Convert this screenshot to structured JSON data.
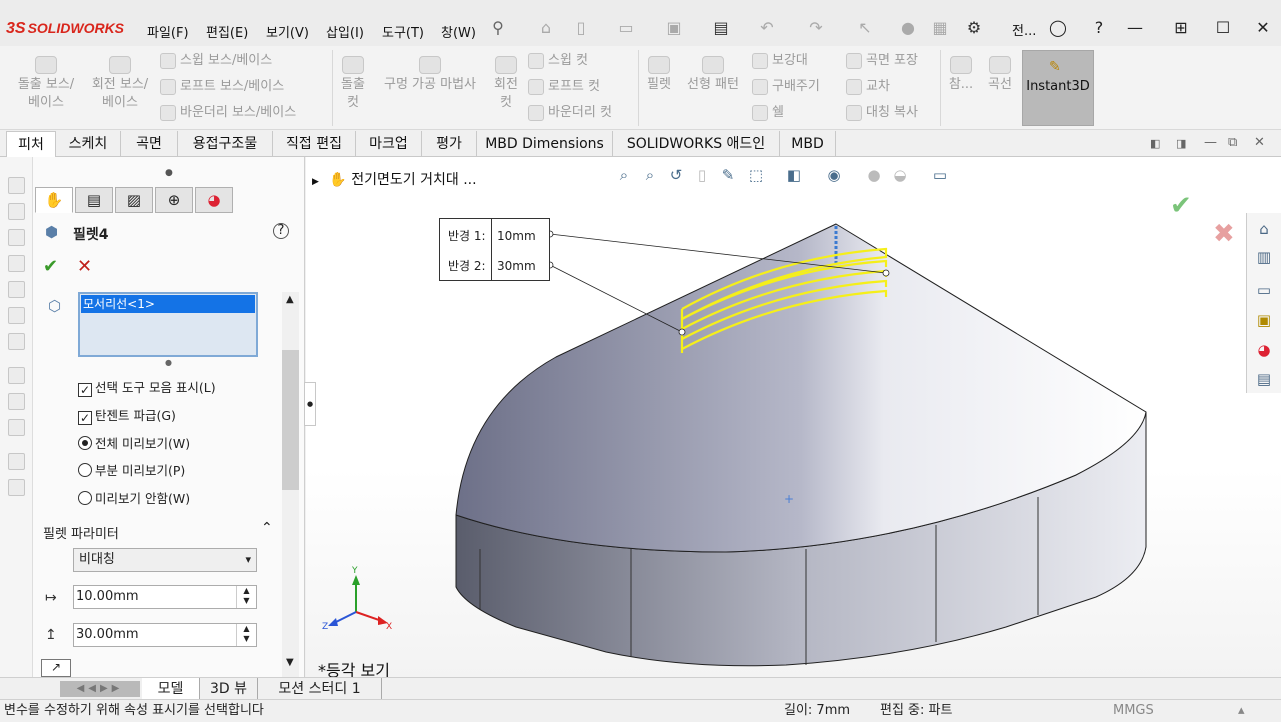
{
  "app": {
    "logo_prefix": "3S",
    "logo_text": "SOLIDWORKS",
    "doc_title_short": "전..."
  },
  "menu": [
    "파일(F)",
    "편집(E)",
    "보기(V)",
    "삽입(I)",
    "도구(T)",
    "창(W)"
  ],
  "command_manager": {
    "extrude_boss": [
      "돌출 보스/",
      "베이스"
    ],
    "revolve_boss": [
      "회전 보스/",
      "베이스"
    ],
    "sweep_boss": "스윕 보스/베이스",
    "loft_boss": "로프트 보스/베이스",
    "boundary_boss": "바운더리 보스/베이스",
    "extrude_cut": [
      "돌출",
      "컷"
    ],
    "hole_wizard": "구멍 가공 마법사",
    "revolve_cut": [
      "회전",
      "컷"
    ],
    "sweep_cut": "스윕 컷",
    "loft_cut": "로프트 컷",
    "boundary_cut": "바운더리 컷",
    "fillet": "필렛",
    "linear_pattern": "선형 패턴",
    "rib": "보강대",
    "draft": "구배주기",
    "shell": "쉘",
    "wrap": "곡면 포장",
    "intersect": "교차",
    "mirror": "대칭 복사",
    "reference": "참...",
    "curves": "곡선",
    "instant3d": "Instant3D"
  },
  "tabs": [
    "피처",
    "스케치",
    "곡면",
    "용접구조물",
    "직접 편집",
    "마크업",
    "평가",
    "MBD Dimensions",
    "SOLIDWORKS 애드인",
    "MBD"
  ],
  "property_manager": {
    "title": "필렛4",
    "edge_item": "모서리선<1>",
    "options": [
      {
        "label": "선택 도구 모음 표시(L)",
        "type": "checkbox",
        "checked": true
      },
      {
        "label": "탄젠트 파급(G)",
        "type": "checkbox",
        "checked": true
      },
      {
        "label": "전체 미리보기(W)",
        "type": "radio",
        "checked": true
      },
      {
        "label": "부분 미리보기(P)",
        "type": "radio",
        "checked": false
      },
      {
        "label": "미리보기 안함(W)",
        "type": "radio",
        "checked": false
      }
    ],
    "param_header": "필렛 파라미터",
    "profile": "비대칭",
    "radius1": "10.00mm",
    "radius2": "30.00mm"
  },
  "viewport": {
    "tree_root": "전기면도기 거치대 ...",
    "view_label": "*등각 보기",
    "callout": [
      {
        "label": "반경 1:",
        "value": "10mm"
      },
      {
        "label": "반경 2:",
        "value": "30mm"
      }
    ],
    "triad": {
      "x": "X",
      "y": "Y",
      "z": "Z"
    }
  },
  "bottom_tabs": [
    "모델",
    "3D 뷰",
    "모션 스터디 1"
  ],
  "status": {
    "message": "변수를 수정하기 위해 속성 표시기를 선택합니다",
    "length": "길이: 7mm",
    "mode": "편집 중: 파트",
    "units": "MMGS"
  },
  "colors": {
    "accent": "#1473e6",
    "fillet_preview": "#f5ef1a",
    "logo": "#d9261c",
    "model_top": "#9da0b5"
  }
}
